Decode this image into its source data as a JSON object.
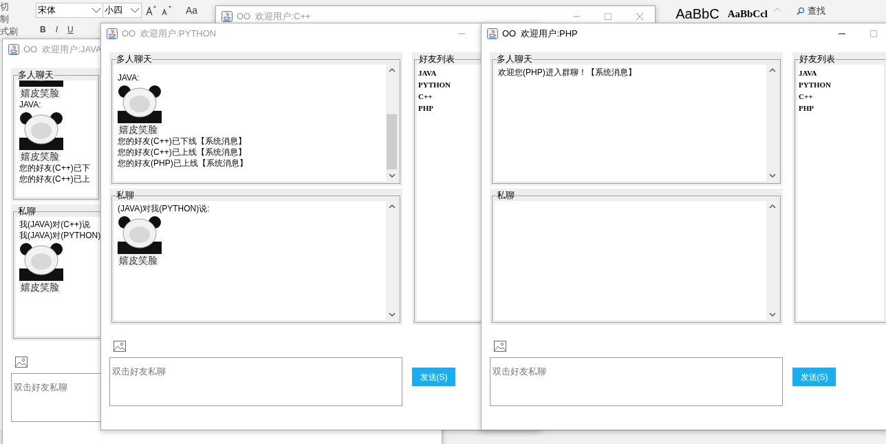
{
  "background_app": {
    "clipboard_labels": [
      "切",
      "制",
      "式刷"
    ],
    "font_name": "宋体",
    "font_size": "小四",
    "case_button": "Aa",
    "format_buttons": [
      "B",
      "I",
      "U"
    ],
    "styles": [
      "AaBbC",
      "AaBbCcl"
    ],
    "find_button": "查找"
  },
  "windows": [
    {
      "title": "OO  欢迎用户:JAVA",
      "active": false,
      "group_chat": {
        "title": "多人聊天",
        "overflowing": true,
        "messages": [
          {
            "kind": "sticker"
          },
          {
            "kind": "caption",
            "text": "嬉皮笑脸"
          },
          {
            "kind": "text",
            "text": "JAVA:"
          },
          {
            "kind": "sticker"
          },
          {
            "kind": "caption",
            "text": "嬉皮笑脸"
          },
          {
            "kind": "text",
            "text": "您的好友(C++)已下"
          },
          {
            "kind": "text",
            "text": "您的好友(C++)已上"
          }
        ]
      },
      "private_chat": {
        "title": "私聊",
        "messages": [
          {
            "kind": "text",
            "text": "我(JAVA)对(C++)说"
          },
          {
            "kind": "text",
            "text": "我(JAVA)对(PYTHON)"
          },
          {
            "kind": "sticker"
          },
          {
            "kind": "caption",
            "text": "嬉皮笑脸"
          }
        ]
      },
      "input": {
        "placeholder": "双击好友私聊"
      }
    },
    {
      "title": "OO  欢迎用户:C++",
      "active": false
    },
    {
      "title": "OO  欢迎用户:PYTHON",
      "active": false,
      "group_chat": {
        "title": "多人聊天",
        "overflowing": true,
        "messages": [
          {
            "kind": "text",
            "text": "JAVA:"
          },
          {
            "kind": "sticker"
          },
          {
            "kind": "caption",
            "text": "嬉皮笑脸"
          },
          {
            "kind": "text",
            "text": "您的好友(C++)已下线【系统消息】"
          },
          {
            "kind": "text",
            "text": "您的好友(C++)已上线【系统消息】"
          },
          {
            "kind": "text",
            "text": "您的好友(PHP)已上线【系统消息】"
          }
        ]
      },
      "private_chat": {
        "title": "私聊",
        "messages": [
          {
            "kind": "text",
            "text": "(JAVA)对我(PYTHON)说:"
          },
          {
            "kind": "sticker"
          },
          {
            "kind": "caption",
            "text": "嬉皮笑脸"
          }
        ]
      },
      "friends": {
        "title": "好友列表",
        "items": [
          "JAVA",
          "PYTHON",
          "C++",
          "PHP"
        ]
      },
      "input": {
        "placeholder": "双击好友私聊"
      },
      "send_button": "发送(S)"
    },
    {
      "title": "OO  欢迎用户:PHP",
      "active": true,
      "group_chat": {
        "title": "多人聊天",
        "overflowing": false,
        "messages": [
          {
            "kind": "text",
            "text": "欢迎您(PHP)进入群聊！【系统消息】"
          }
        ]
      },
      "private_chat": {
        "title": "私聊"
      },
      "friends": {
        "title": "好友列表",
        "items": [
          "JAVA",
          "PYTHON",
          "C++",
          "PHP"
        ]
      },
      "input": {
        "placeholder": "双击好友私聊"
      },
      "send_button": "发送(S)"
    }
  ]
}
